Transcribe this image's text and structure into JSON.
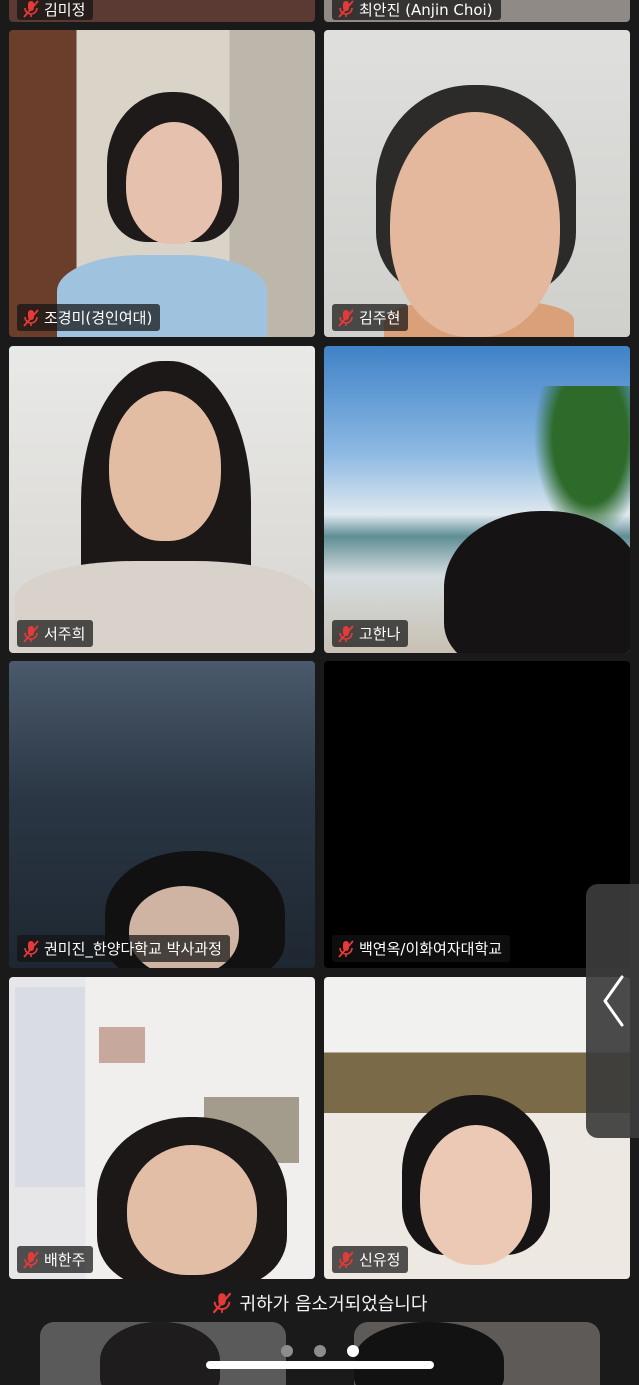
{
  "participants_top": [
    {
      "name": "김미정"
    },
    {
      "name": "최안진 (Anjin Choi)"
    }
  ],
  "participants": [
    {
      "name": "조경미(경인여대)"
    },
    {
      "name": "김주현"
    },
    {
      "name": "서주희"
    },
    {
      "name": "고한나"
    },
    {
      "name": "권미진_한양다학교 박사과정"
    },
    {
      "name": "백연옥/이화여자대학교"
    },
    {
      "name": "배한주"
    },
    {
      "name": "신유정"
    }
  ],
  "notice": {
    "text": "귀하가 음소거되었습니다"
  },
  "pager": {
    "pages": 3,
    "active": 3
  },
  "icons": {
    "muted": "mic-muted-icon",
    "collapse": "chevron-left-icon"
  },
  "colors": {
    "mute_red": "#e8393a",
    "background": "#1a1a1a"
  }
}
